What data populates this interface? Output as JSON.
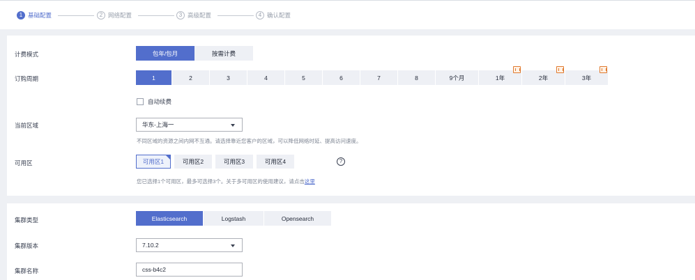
{
  "steps": [
    {
      "num": "1",
      "label": "基础配置"
    },
    {
      "num": "2",
      "label": "网络配置"
    },
    {
      "num": "3",
      "label": "高级配置"
    },
    {
      "num": "4",
      "label": "确认配置"
    }
  ],
  "billing": {
    "label": "计费模式",
    "options": [
      "包年/包月",
      "按需计费"
    ],
    "selected": "包年/包月"
  },
  "period": {
    "label": "订购周期",
    "options": [
      "1",
      "2",
      "3",
      "4",
      "5",
      "6",
      "7",
      "8",
      "9个月",
      "1年",
      "2年",
      "3年"
    ],
    "selected": "1",
    "badge_icon": "discount-icon",
    "auto_renew_label": "自动续费"
  },
  "region": {
    "label": "当前区域",
    "value": "华东-上海一",
    "hint": "不同区域的资源之间内网不互通。请选择靠近您客户的区域，可以降低网络时延、提高访问速度。"
  },
  "az": {
    "label": "可用区",
    "options": [
      "可用区1",
      "可用区2",
      "可用区3",
      "可用区4"
    ],
    "selected": "可用区1",
    "help": "?",
    "hint": "您已选择1个可用区，最多可选择3个。关于多可用区的使用建议，请点击",
    "hint_link": "这里"
  },
  "cluster_type": {
    "label": "集群类型",
    "options": [
      "Elasticsearch",
      "Logstash",
      "Opensearch"
    ],
    "selected": "Elasticsearch"
  },
  "cluster_version": {
    "label": "集群版本",
    "value": "7.10.2"
  },
  "cluster_name": {
    "label": "集群名称",
    "value": "css-b4c2"
  },
  "colors": {
    "accent": "#526ecc",
    "discount": "#e07a2f"
  }
}
